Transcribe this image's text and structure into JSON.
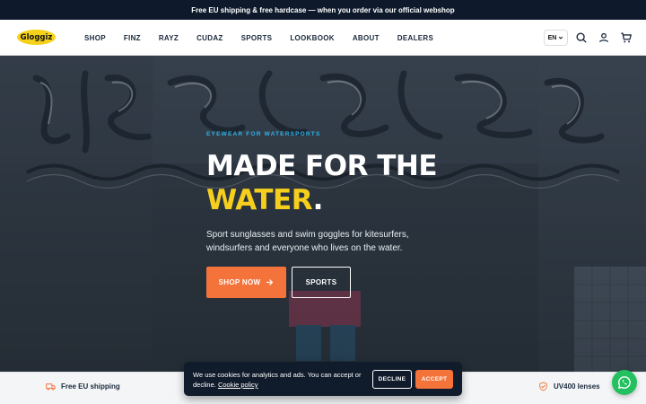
{
  "announcement": "Free EU shipping & free hardcase — when you order via our official webshop",
  "brand": {
    "logo_text": "Gloggiz",
    "logo_color": "#f5d21a"
  },
  "nav": [
    {
      "label": "SHOP"
    },
    {
      "label": "FINZ"
    },
    {
      "label": "RAYZ"
    },
    {
      "label": "CUDAZ"
    },
    {
      "label": "SPORTS"
    },
    {
      "label": "LOOKBOOK"
    },
    {
      "label": "ABOUT"
    },
    {
      "label": "DEALERS"
    }
  ],
  "header_actions": {
    "language": "EN",
    "icons": [
      "chevron-down-icon",
      "search-icon",
      "user-icon",
      "cart-icon"
    ]
  },
  "hero": {
    "eyebrow": "EYEWEAR FOR WATERSPORTS",
    "headline_line1": "MADE FOR THE",
    "headline_accent": "WATER",
    "headline_period": ".",
    "description": "Sport sunglasses and swim goggles for kitesurfers, windsurfers and everyone who lives on the water.",
    "primary_button": "SHOP NOW",
    "secondary_button": "SPORTS",
    "graffiti_text": "KITE COFECO!",
    "accent_color": "#f6cf1e",
    "button_color": "#f4733a",
    "eyebrow_color": "#2fb4ea"
  },
  "features": [
    {
      "label": "Free EU shipping",
      "icon": "truck-icon"
    },
    {
      "label": "UV400 lenses",
      "icon": "shield-icon"
    }
  ],
  "cookie": {
    "text": "We use cookies for analytics and ads. You can accept or decline.",
    "policy_link": "Cookie policy",
    "decline": "DECLINE",
    "accept": "ACCEPT"
  },
  "chat": {
    "icon": "whatsapp-icon",
    "color": "#22c05e"
  }
}
